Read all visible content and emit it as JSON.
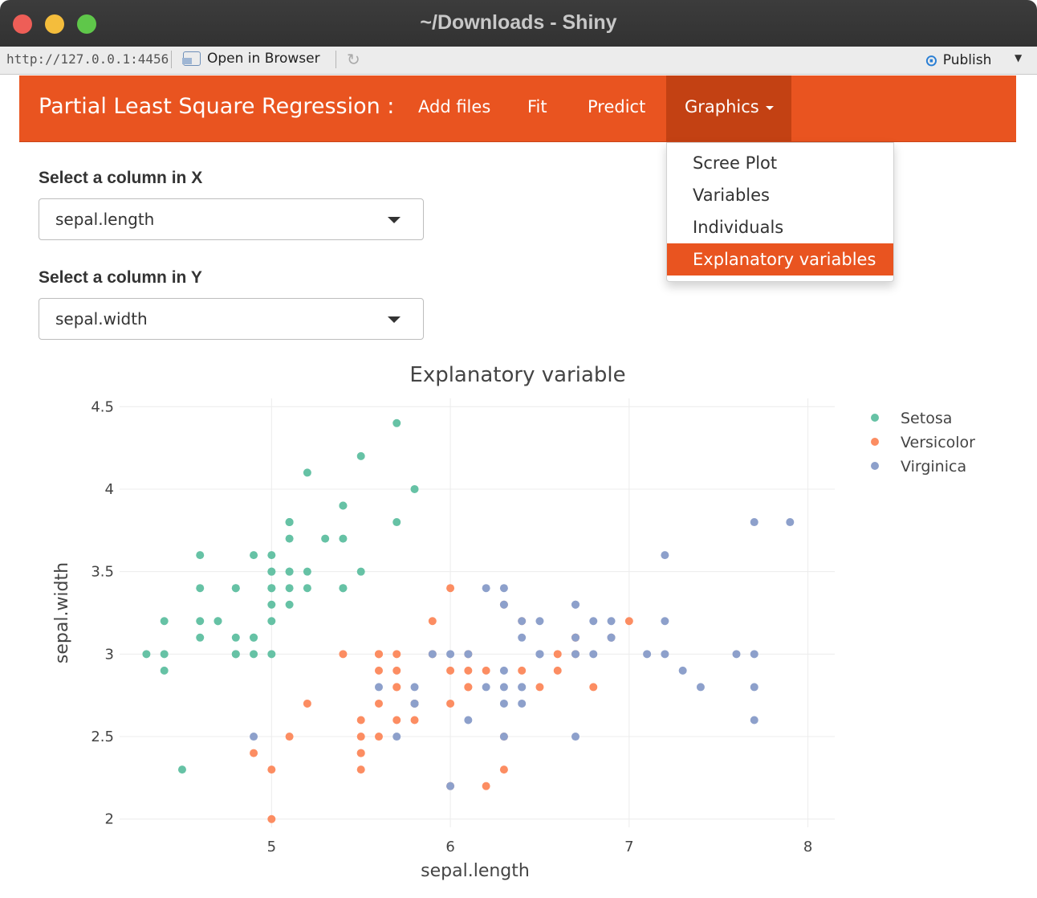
{
  "window": {
    "title": "~/Downloads - Shiny"
  },
  "toolbar": {
    "url": "http://127.0.0.1:4456",
    "open_in_browser": "Open in Browser",
    "publish": "Publish"
  },
  "navbar": {
    "brand": "Partial Least Square Regression :",
    "items": [
      "Add files",
      "Fit",
      "Predict",
      "Graphics"
    ],
    "active": "Graphics"
  },
  "dropdown": {
    "items": [
      "Scree Plot",
      "Variables",
      "Individuals",
      "Explanatory variables"
    ],
    "active": "Explanatory variables"
  },
  "form": {
    "x_label": "Select a column in X",
    "x_value": "sepal.length",
    "y_label": "Select a column in Y",
    "y_value": "sepal.width"
  },
  "chart_data": {
    "type": "scatter",
    "title": "Explanatory variable",
    "xlabel": "sepal.length",
    "ylabel": "sepal.width",
    "xlim": [
      4.15,
      8.15
    ],
    "ylim": [
      1.95,
      4.55
    ],
    "xticks": [
      5,
      6,
      7,
      8
    ],
    "yticks": [
      2,
      2.5,
      3,
      3.5,
      4,
      4.5
    ],
    "ytick_labels": [
      "2",
      "2.5",
      "3",
      "3.5",
      "4",
      "4.5"
    ],
    "grid": true,
    "legend_position": "top-right",
    "series": [
      {
        "name": "Setosa",
        "color": "#66c2a5",
        "points": [
          [
            5.1,
            3.5
          ],
          [
            4.9,
            3.0
          ],
          [
            4.7,
            3.2
          ],
          [
            4.6,
            3.1
          ],
          [
            5.0,
            3.6
          ],
          [
            5.4,
            3.9
          ],
          [
            4.6,
            3.4
          ],
          [
            5.0,
            3.4
          ],
          [
            4.4,
            2.9
          ],
          [
            4.9,
            3.1
          ],
          [
            5.4,
            3.7
          ],
          [
            4.8,
            3.4
          ],
          [
            4.8,
            3.0
          ],
          [
            4.3,
            3.0
          ],
          [
            5.8,
            4.0
          ],
          [
            5.7,
            4.4
          ],
          [
            5.4,
            3.9
          ],
          [
            5.1,
            3.5
          ],
          [
            5.7,
            3.8
          ],
          [
            5.1,
            3.8
          ],
          [
            5.4,
            3.4
          ],
          [
            5.1,
            3.7
          ],
          [
            4.6,
            3.6
          ],
          [
            5.1,
            3.3
          ],
          [
            4.8,
            3.4
          ],
          [
            5.0,
            3.0
          ],
          [
            5.0,
            3.4
          ],
          [
            5.2,
            3.5
          ],
          [
            5.2,
            3.4
          ],
          [
            4.7,
            3.2
          ],
          [
            4.8,
            3.1
          ],
          [
            5.4,
            3.4
          ],
          [
            5.2,
            4.1
          ],
          [
            5.5,
            4.2
          ],
          [
            4.9,
            3.1
          ],
          [
            5.0,
            3.2
          ],
          [
            5.5,
            3.5
          ],
          [
            4.9,
            3.6
          ],
          [
            4.4,
            3.0
          ],
          [
            5.1,
            3.4
          ],
          [
            5.0,
            3.5
          ],
          [
            4.5,
            2.3
          ],
          [
            4.4,
            3.2
          ],
          [
            5.0,
            3.5
          ],
          [
            5.1,
            3.8
          ],
          [
            4.8,
            3.0
          ],
          [
            5.1,
            3.8
          ],
          [
            4.6,
            3.2
          ],
          [
            5.3,
            3.7
          ],
          [
            5.0,
            3.3
          ]
        ]
      },
      {
        "name": "Versicolor",
        "color": "#fc8d62",
        "points": [
          [
            7.0,
            3.2
          ],
          [
            6.4,
            3.2
          ],
          [
            6.9,
            3.1
          ],
          [
            5.5,
            2.3
          ],
          [
            6.5,
            2.8
          ],
          [
            5.7,
            2.8
          ],
          [
            6.3,
            3.3
          ],
          [
            4.9,
            2.4
          ],
          [
            6.6,
            2.9
          ],
          [
            5.2,
            2.7
          ],
          [
            5.0,
            2.0
          ],
          [
            5.9,
            3.0
          ],
          [
            6.0,
            2.2
          ],
          [
            6.1,
            2.9
          ],
          [
            5.6,
            2.9
          ],
          [
            6.7,
            3.1
          ],
          [
            5.6,
            3.0
          ],
          [
            5.8,
            2.7
          ],
          [
            6.2,
            2.2
          ],
          [
            5.6,
            2.5
          ],
          [
            5.9,
            3.2
          ],
          [
            6.1,
            2.8
          ],
          [
            6.3,
            2.5
          ],
          [
            6.1,
            2.8
          ],
          [
            6.4,
            2.9
          ],
          [
            6.6,
            3.0
          ],
          [
            6.8,
            2.8
          ],
          [
            6.7,
            3.0
          ],
          [
            6.0,
            2.9
          ],
          [
            5.7,
            2.6
          ],
          [
            5.5,
            2.4
          ],
          [
            5.5,
            2.4
          ],
          [
            5.8,
            2.7
          ],
          [
            6.0,
            2.7
          ],
          [
            5.4,
            3.0
          ],
          [
            6.0,
            3.4
          ],
          [
            6.7,
            3.1
          ],
          [
            6.3,
            2.3
          ],
          [
            5.6,
            3.0
          ],
          [
            5.5,
            2.5
          ],
          [
            5.5,
            2.6
          ],
          [
            6.1,
            3.0
          ],
          [
            5.8,
            2.6
          ],
          [
            5.0,
            2.3
          ],
          [
            5.6,
            2.7
          ],
          [
            5.7,
            3.0
          ],
          [
            5.7,
            2.9
          ],
          [
            6.2,
            2.9
          ],
          [
            5.1,
            2.5
          ],
          [
            5.7,
            2.8
          ]
        ]
      },
      {
        "name": "Virginica",
        "color": "#8da0cb",
        "points": [
          [
            6.3,
            3.3
          ],
          [
            5.8,
            2.7
          ],
          [
            7.1,
            3.0
          ],
          [
            6.3,
            2.9
          ],
          [
            6.5,
            3.0
          ],
          [
            7.6,
            3.0
          ],
          [
            4.9,
            2.5
          ],
          [
            7.3,
            2.9
          ],
          [
            6.7,
            2.5
          ],
          [
            7.2,
            3.6
          ],
          [
            6.5,
            3.2
          ],
          [
            6.4,
            2.7
          ],
          [
            6.8,
            3.0
          ],
          [
            5.7,
            2.5
          ],
          [
            5.8,
            2.8
          ],
          [
            6.4,
            3.2
          ],
          [
            6.5,
            3.0
          ],
          [
            7.7,
            3.8
          ],
          [
            7.7,
            2.6
          ],
          [
            6.0,
            2.2
          ],
          [
            6.9,
            3.2
          ],
          [
            5.6,
            2.8
          ],
          [
            7.7,
            2.8
          ],
          [
            6.3,
            2.7
          ],
          [
            6.7,
            3.3
          ],
          [
            7.2,
            3.2
          ],
          [
            6.2,
            2.8
          ],
          [
            6.1,
            3.0
          ],
          [
            6.4,
            2.8
          ],
          [
            7.2,
            3.0
          ],
          [
            7.4,
            2.8
          ],
          [
            7.9,
            3.8
          ],
          [
            6.4,
            2.8
          ],
          [
            6.3,
            2.8
          ],
          [
            6.1,
            2.6
          ],
          [
            7.7,
            3.0
          ],
          [
            6.3,
            3.4
          ],
          [
            6.4,
            3.1
          ],
          [
            6.0,
            3.0
          ],
          [
            6.9,
            3.1
          ],
          [
            6.7,
            3.1
          ],
          [
            6.9,
            3.1
          ],
          [
            5.8,
            2.7
          ],
          [
            6.8,
            3.2
          ],
          [
            6.7,
            3.3
          ],
          [
            6.7,
            3.0
          ],
          [
            6.3,
            2.5
          ],
          [
            6.5,
            3.0
          ],
          [
            6.2,
            3.4
          ],
          [
            5.9,
            3.0
          ]
        ]
      }
    ]
  }
}
